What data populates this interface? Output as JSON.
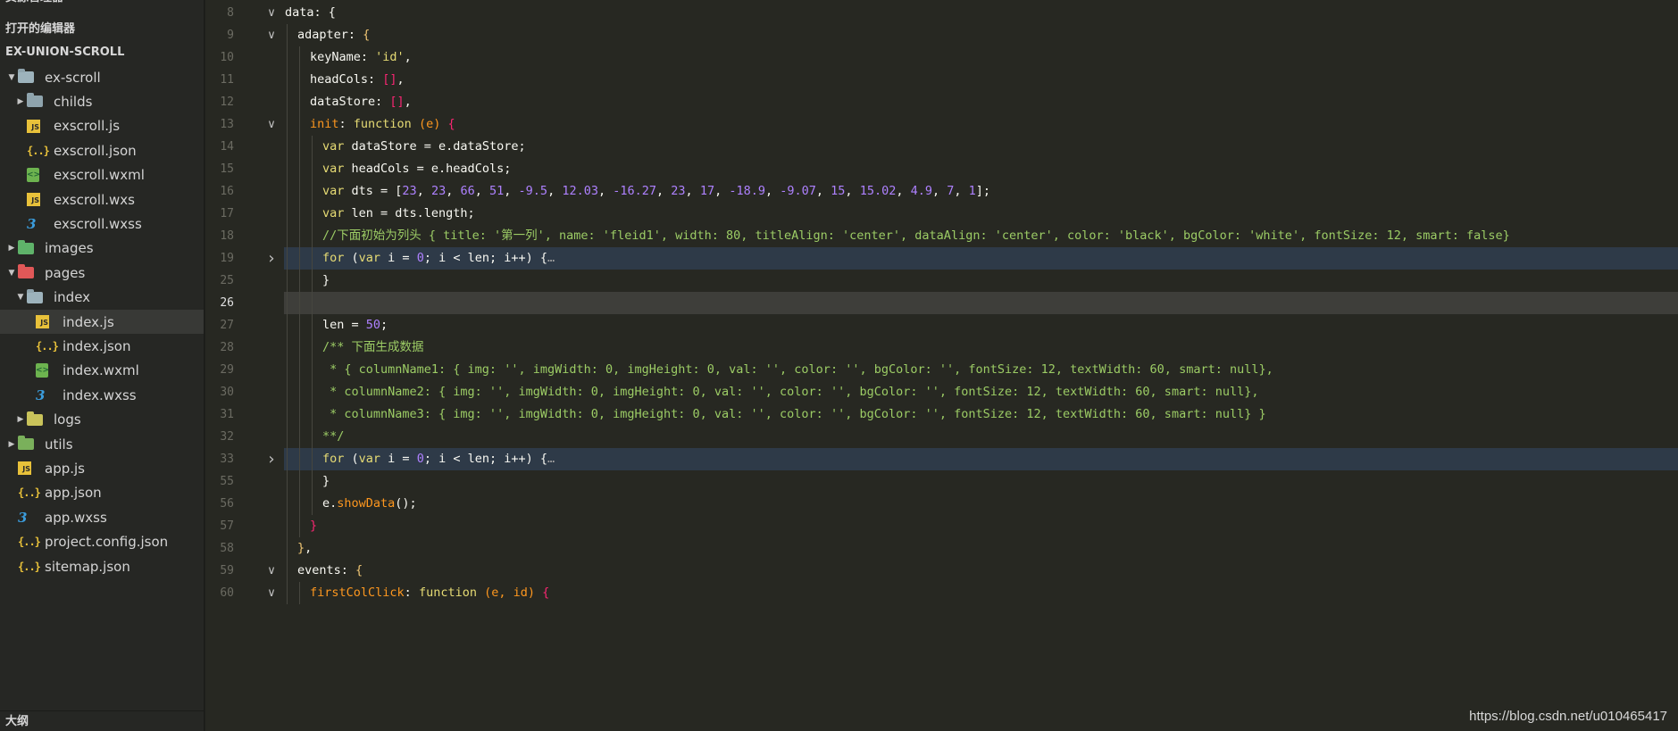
{
  "sidebar": {
    "explorer_title": "资源管理器",
    "open_editors_title": "打开的编辑器",
    "project_title": "EX-UNION-SCROLL",
    "outline_title": "大纲",
    "tree": [
      {
        "label": "ex-scroll",
        "type": "folder-open",
        "depth": 0,
        "chevron": "down"
      },
      {
        "label": "childs",
        "type": "folder",
        "depth": 1,
        "chevron": "right"
      },
      {
        "label": "exscroll.js",
        "type": "js",
        "depth": 1
      },
      {
        "label": "exscroll.json",
        "type": "json",
        "depth": 1
      },
      {
        "label": "exscroll.wxml",
        "type": "wxml",
        "depth": 1
      },
      {
        "label": "exscroll.wxs",
        "type": "js",
        "depth": 1
      },
      {
        "label": "exscroll.wxss",
        "type": "wxss",
        "depth": 1
      },
      {
        "label": "images",
        "type": "folder-img",
        "depth": 0,
        "chevron": "right"
      },
      {
        "label": "pages",
        "type": "folder-pages",
        "depth": 0,
        "chevron": "down"
      },
      {
        "label": "index",
        "type": "folder-open",
        "depth": 1,
        "chevron": "down"
      },
      {
        "label": "index.js",
        "type": "js",
        "depth": 2,
        "selected": true
      },
      {
        "label": "index.json",
        "type": "json",
        "depth": 2
      },
      {
        "label": "index.wxml",
        "type": "wxml",
        "depth": 2
      },
      {
        "label": "index.wxss",
        "type": "wxss",
        "depth": 2
      },
      {
        "label": "logs",
        "type": "folder-logs",
        "depth": 1,
        "chevron": "right"
      },
      {
        "label": "utils",
        "type": "folder-utils",
        "depth": 0,
        "chevron": "right"
      },
      {
        "label": "app.js",
        "type": "js",
        "depth": 0
      },
      {
        "label": "app.json",
        "type": "json",
        "depth": 0
      },
      {
        "label": "app.wxss",
        "type": "wxss",
        "depth": 0
      },
      {
        "label": "project.config.json",
        "type": "json",
        "depth": 0
      },
      {
        "label": "sitemap.json",
        "type": "json",
        "depth": 0
      }
    ]
  },
  "editor": {
    "current_line": 26,
    "lines": [
      {
        "num": "8",
        "fold": "down",
        "indent": 0,
        "tokens": [
          [
            "",
            "data: {"
          ]
        ]
      },
      {
        "num": "9",
        "fold": "down",
        "indent": 1,
        "tokens": [
          [
            "",
            "adapter: "
          ],
          [
            "y",
            "{"
          ]
        ]
      },
      {
        "num": "10",
        "indent": 2,
        "tokens": [
          [
            "",
            "keyName: "
          ],
          [
            "s",
            "'id'"
          ],
          [
            "",
            ","
          ]
        ]
      },
      {
        "num": "11",
        "indent": 2,
        "tokens": [
          [
            "",
            "headCols: "
          ],
          [
            "r",
            "[]"
          ],
          [
            "",
            ","
          ]
        ]
      },
      {
        "num": "12",
        "indent": 2,
        "tokens": [
          [
            "",
            "dataStore: "
          ],
          [
            "r",
            "[]"
          ],
          [
            "",
            ","
          ]
        ]
      },
      {
        "num": "13",
        "fold": "down",
        "indent": 2,
        "tokens": [
          [
            "f",
            "init"
          ],
          [
            "",
            ": "
          ],
          [
            "kv",
            "function"
          ],
          [
            "",
            "",
            " "
          ],
          [
            "p",
            " (e)"
          ],
          [
            "",
            "",
            " "
          ],
          [
            "r",
            " {"
          ]
        ]
      },
      {
        "num": "14",
        "indent": 3,
        "tokens": [
          [
            "kv",
            "var"
          ],
          [
            "",
            " dataStore = e.dataStore;"
          ]
        ]
      },
      {
        "num": "15",
        "indent": 3,
        "tokens": [
          [
            "kv",
            "var"
          ],
          [
            "",
            " headCols = e.headCols;"
          ]
        ]
      },
      {
        "num": "16",
        "indent": 3,
        "tokens": [
          [
            "kv",
            "var"
          ],
          [
            "",
            " dts = ["
          ],
          [
            "n",
            "23"
          ],
          [
            "",
            ", "
          ],
          [
            "n",
            "23"
          ],
          [
            "",
            ", "
          ],
          [
            "n",
            "66"
          ],
          [
            "",
            ", "
          ],
          [
            "n",
            "51"
          ],
          [
            "",
            ", "
          ],
          [
            "n",
            "-9.5"
          ],
          [
            "",
            ", "
          ],
          [
            "n",
            "12.03"
          ],
          [
            "",
            ", "
          ],
          [
            "n",
            "-16.27"
          ],
          [
            "",
            ", "
          ],
          [
            "n",
            "23"
          ],
          [
            "",
            ", "
          ],
          [
            "n",
            "17"
          ],
          [
            "",
            ", "
          ],
          [
            "n",
            "-18.9"
          ],
          [
            "",
            ", "
          ],
          [
            "n",
            "-9.07"
          ],
          [
            "",
            ", "
          ],
          [
            "n",
            "15"
          ],
          [
            "",
            ", "
          ],
          [
            "n",
            "15.02"
          ],
          [
            "",
            ", "
          ],
          [
            "n",
            "4.9"
          ],
          [
            "",
            ", "
          ],
          [
            "n",
            "7"
          ],
          [
            "",
            ", "
          ],
          [
            "n",
            "1"
          ],
          [
            "",
            "];"
          ]
        ]
      },
      {
        "num": "17",
        "indent": 3,
        "tokens": [
          [
            "kv",
            "var"
          ],
          [
            "",
            " len = dts.length;"
          ]
        ]
      },
      {
        "num": "18",
        "indent": 3,
        "tokens": [
          [
            "c",
            "//下面初始为列头 { title: '第一列', name: 'fleid1', width: 80, titleAlign: 'center', dataAlign: 'center', color: 'black', bgColor: 'white', fontSize: 12, smart: false}"
          ]
        ]
      },
      {
        "num": "19",
        "fold": "right",
        "indent": 3,
        "hl": true,
        "tokens": [
          [
            "kv",
            "for"
          ],
          [
            "",
            " ("
          ],
          [
            "kv",
            "var"
          ],
          [
            "",
            " i = "
          ],
          [
            "n",
            "0"
          ],
          [
            "",
            "; i < len; i++) {"
          ],
          [
            "fold-dots",
            "…"
          ]
        ]
      },
      {
        "num": "25",
        "indent": 3,
        "tokens": [
          [
            "",
            "}"
          ]
        ]
      },
      {
        "num": "26",
        "indent": 3,
        "cur": true,
        "tokens": [
          [
            "",
            ""
          ]
        ]
      },
      {
        "num": "27",
        "indent": 3,
        "tokens": [
          [
            "",
            "len = "
          ],
          [
            "n",
            "50"
          ],
          [
            "",
            ";"
          ]
        ]
      },
      {
        "num": "28",
        "indent": 3,
        "tokens": [
          [
            "c",
            "/** 下面生成数据"
          ]
        ]
      },
      {
        "num": "29",
        "indent": 3,
        "tokens": [
          [
            "c",
            " * { columnName1: { img: '', imgWidth: 0, imgHeight: 0, val: '', color: '', bgColor: '', fontSize: 12, textWidth: 60, smart: null},"
          ]
        ]
      },
      {
        "num": "30",
        "indent": 3,
        "tokens": [
          [
            "c",
            " * columnName2: { img: '', imgWidth: 0, imgHeight: 0, val: '', color: '', bgColor: '', fontSize: 12, textWidth: 60, smart: null},"
          ]
        ]
      },
      {
        "num": "31",
        "indent": 3,
        "tokens": [
          [
            "c",
            " * columnName3: { img: '', imgWidth: 0, imgHeight: 0, val: '', color: '', bgColor: '', fontSize: 12, textWidth: 60, smart: null} }"
          ]
        ]
      },
      {
        "num": "32",
        "indent": 3,
        "tokens": [
          [
            "c",
            "**/"
          ]
        ]
      },
      {
        "num": "33",
        "fold": "right",
        "indent": 3,
        "hl": true,
        "tokens": [
          [
            "kv",
            "for"
          ],
          [
            "",
            " ("
          ],
          [
            "kv",
            "var"
          ],
          [
            "",
            " i = "
          ],
          [
            "n",
            "0"
          ],
          [
            "",
            "; i < len; i++) {"
          ],
          [
            "fold-dots",
            "…"
          ]
        ]
      },
      {
        "num": "55",
        "indent": 3,
        "tokens": [
          [
            "",
            "}"
          ]
        ]
      },
      {
        "num": "56",
        "indent": 3,
        "tokens": [
          [
            "",
            "e."
          ],
          [
            "f",
            "showData"
          ],
          [
            "",
            "();"
          ]
        ]
      },
      {
        "num": "57",
        "indent": 2,
        "tokens": [
          [
            "r",
            "}"
          ]
        ]
      },
      {
        "num": "58",
        "indent": 1,
        "tokens": [
          [
            "y",
            "}"
          ],
          [
            "",
            ","
          ]
        ]
      },
      {
        "num": "59",
        "fold": "down",
        "indent": 1,
        "tokens": [
          [
            "",
            "events: "
          ],
          [
            "y",
            "{"
          ]
        ]
      },
      {
        "num": "60",
        "fold": "down",
        "indent": 2,
        "tokens": [
          [
            "f",
            "firstColClick"
          ],
          [
            "",
            ": "
          ],
          [
            "kv",
            "function"
          ],
          [
            "p",
            " (e, id)"
          ],
          [
            "r",
            " {"
          ]
        ]
      }
    ]
  },
  "watermark": "https://blog.csdn.net/u010465417"
}
